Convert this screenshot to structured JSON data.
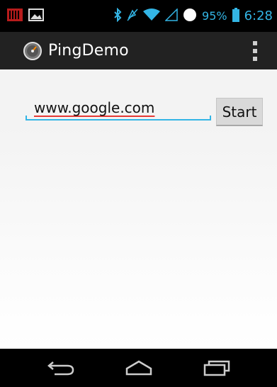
{
  "status_bar": {
    "battery_percent": "95%",
    "time": "6:28",
    "accent_color": "#33b5e5",
    "icons": [
      "notification-bars-icon",
      "image-icon",
      "bluetooth-icon",
      "mute-icon",
      "wifi-icon",
      "cell-signal-icon",
      "sync-circle-icon",
      "battery-icon"
    ]
  },
  "action_bar": {
    "title": "PingDemo",
    "app_icon": "gauge-icon",
    "menu_icon": "overflow-menu-icon"
  },
  "form": {
    "url_value": "www.google.com",
    "start_label": "Start"
  },
  "nav_bar": {
    "buttons": [
      "back-icon",
      "home-icon",
      "recents-icon"
    ]
  }
}
